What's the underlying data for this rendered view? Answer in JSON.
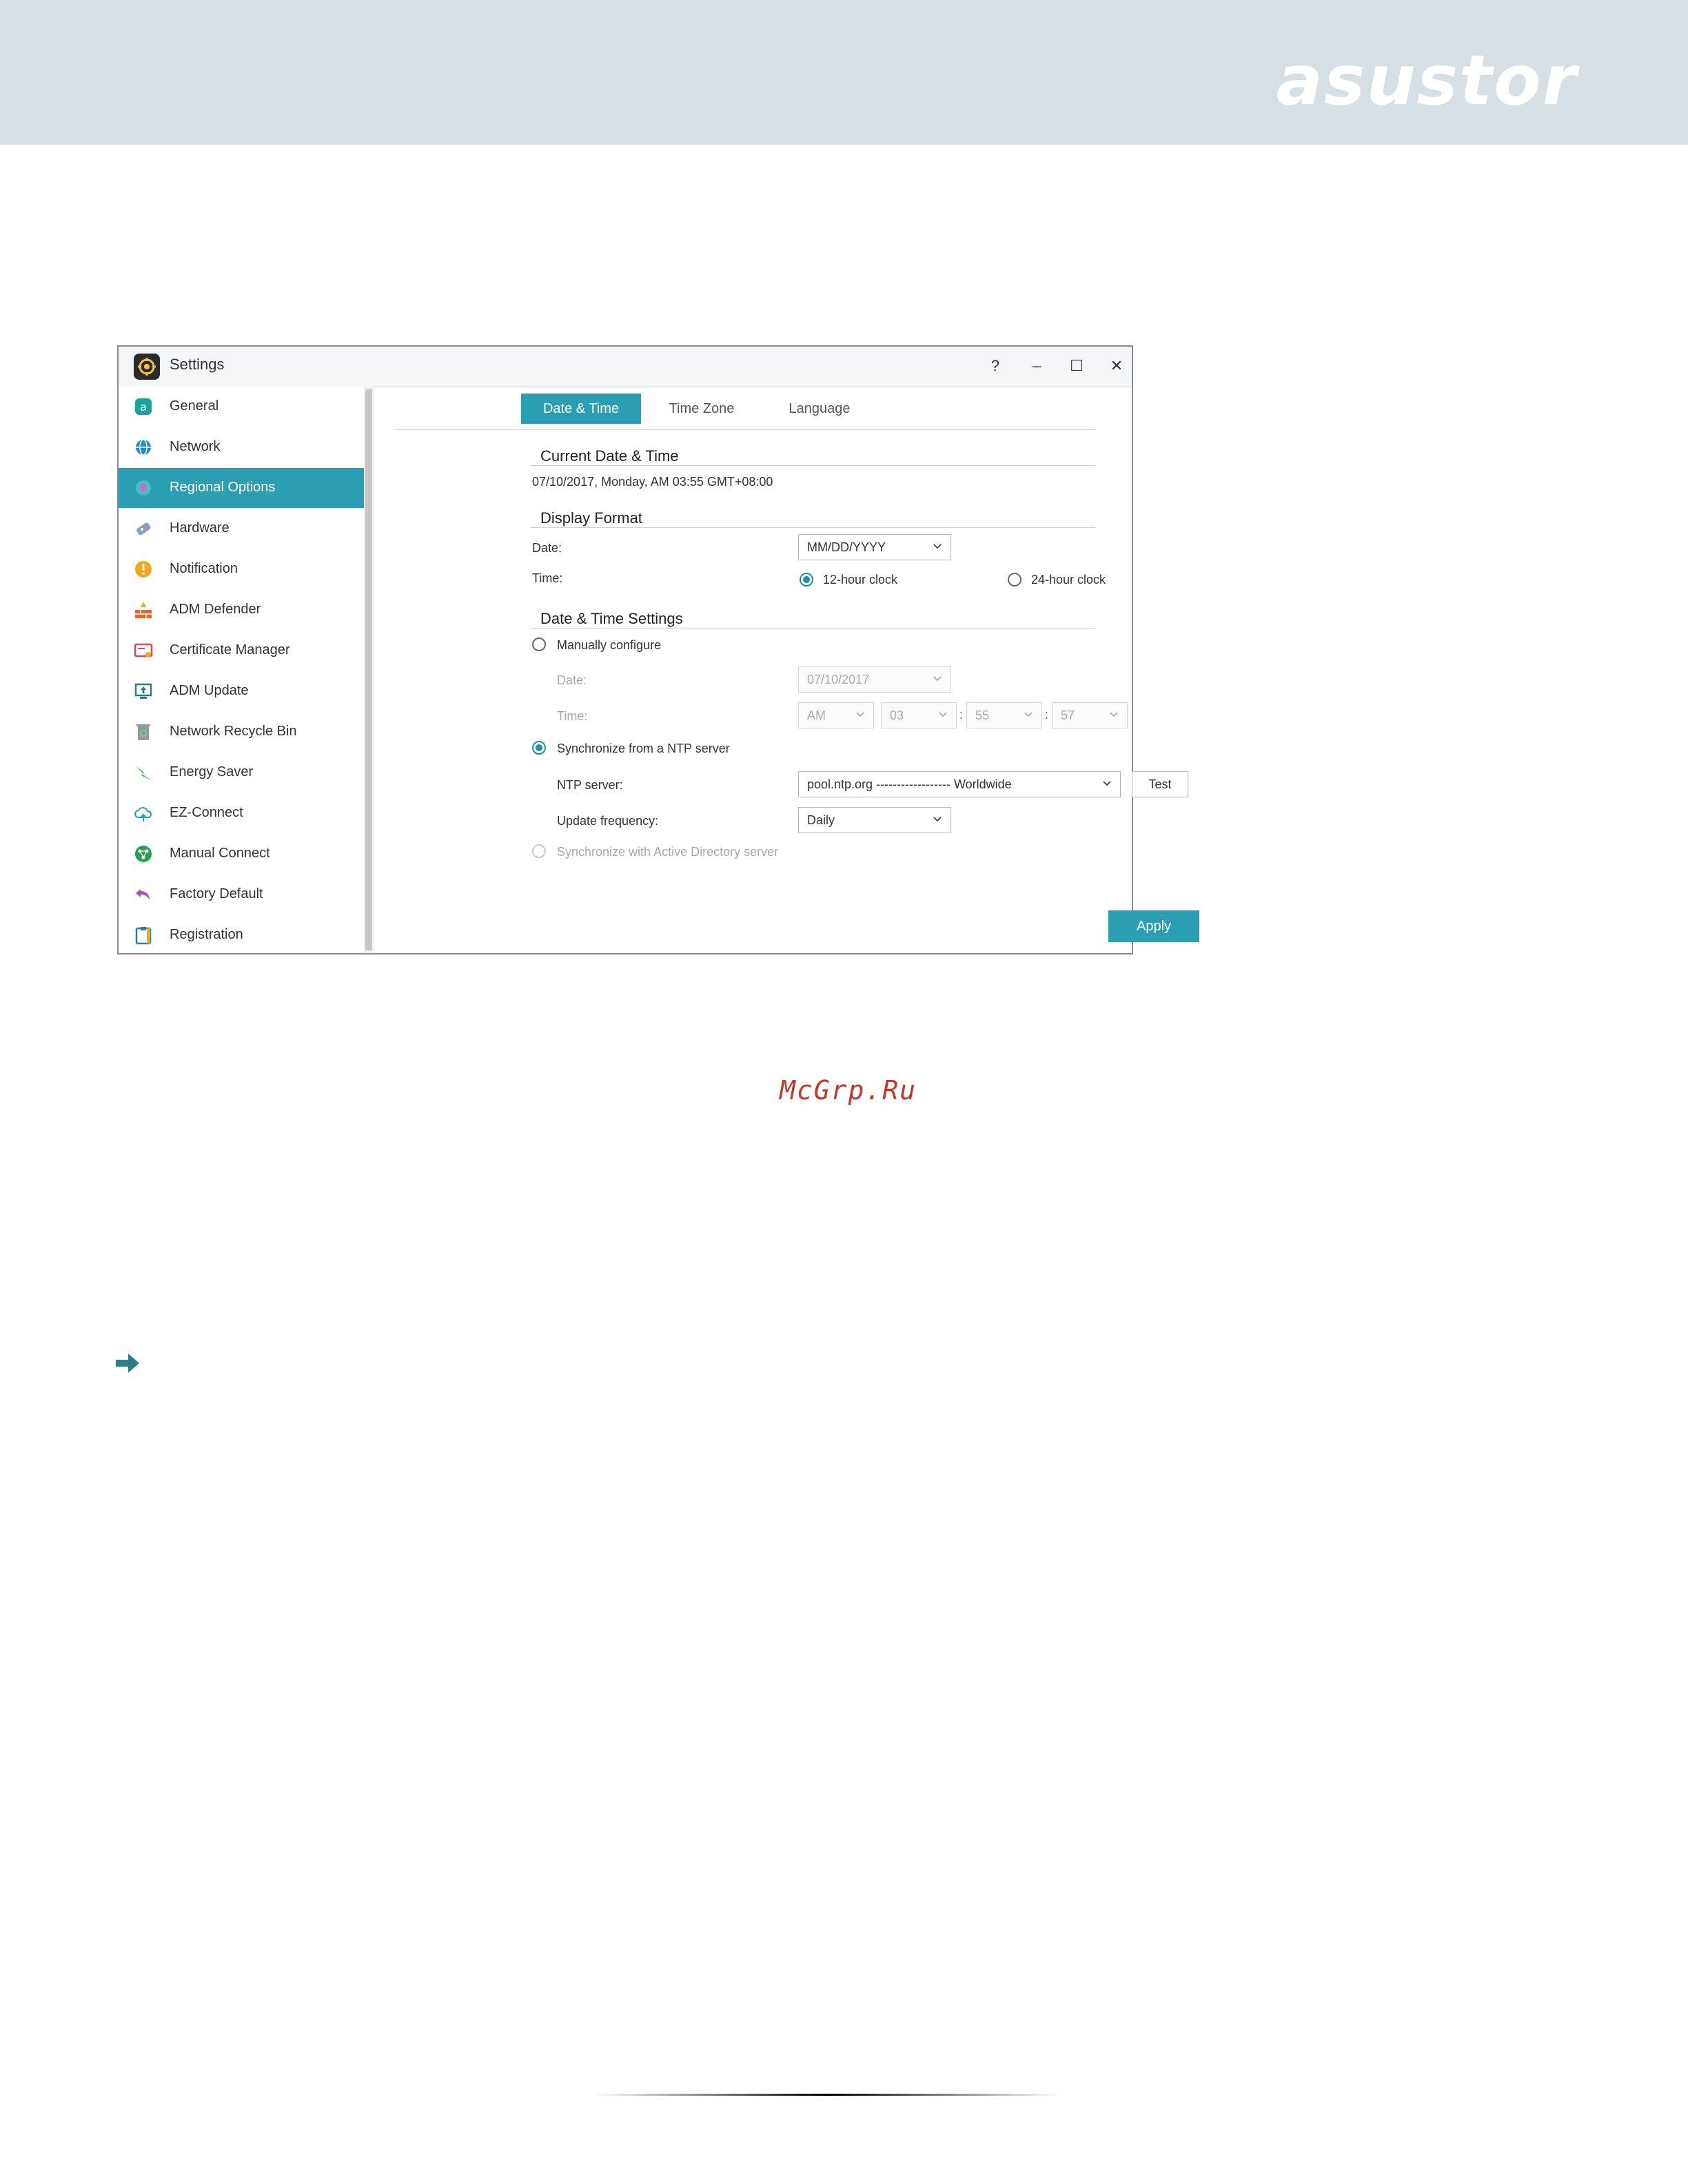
{
  "brand": {
    "logo_text": "asustor"
  },
  "window": {
    "title": "Settings",
    "controls": {
      "help": "?",
      "minimize": "–",
      "maximize": "☐",
      "close": "✕"
    }
  },
  "sidebar": {
    "items": [
      {
        "label": "General",
        "icon": "general-icon",
        "color": "#1aa39b"
      },
      {
        "label": "Network",
        "icon": "globe-icon",
        "color": "#1f8fc4"
      },
      {
        "label": "Regional Options",
        "icon": "map-pin-icon",
        "color": "#e05bc4",
        "active": true
      },
      {
        "label": "Hardware",
        "icon": "hardware-icon",
        "color": "#8aa0b8"
      },
      {
        "label": "Notification",
        "icon": "alert-icon",
        "color": "#f2a81d"
      },
      {
        "label": "ADM Defender",
        "icon": "firewall-icon",
        "color": "#e8632a"
      },
      {
        "label": "Certificate Manager",
        "icon": "certificate-icon",
        "color": "#e0445a"
      },
      {
        "label": "ADM Update",
        "icon": "update-icon",
        "color": "#2a7f78"
      },
      {
        "label": "Network Recycle Bin",
        "icon": "recycle-bin-icon",
        "color": "#8c9aa0"
      },
      {
        "label": "Energy Saver",
        "icon": "energy-icon",
        "color": "#3bb24a"
      },
      {
        "label": "EZ-Connect",
        "icon": "cloud-icon",
        "color": "#2a9fb0"
      },
      {
        "label": "Manual Connect",
        "icon": "manual-connect-icon",
        "color": "#2a9e55"
      },
      {
        "label": "Factory Default",
        "icon": "undo-icon",
        "color": "#b04fc4"
      },
      {
        "label": "Registration",
        "icon": "clipboard-icon",
        "color": "#2a7fb0"
      }
    ]
  },
  "tabs": [
    {
      "label": "Date & Time",
      "active": true
    },
    {
      "label": "Time Zone"
    },
    {
      "label": "Language"
    }
  ],
  "current": {
    "title": "Current Date & Time",
    "value": "07/10/2017, Monday, AM 03:55 GMT+08:00"
  },
  "display_format": {
    "title": "Display Format",
    "date_label": "Date:",
    "date_value": "MM/DD/YYYY",
    "time_label": "Time:",
    "clock12": "12-hour clock",
    "clock24": "24-hour clock",
    "selected": "12-hour clock"
  },
  "settings": {
    "title": "Date & Time Settings",
    "manual_label": "Manually configure",
    "manual_date_label": "Date:",
    "manual_date_value": "07/10/2017",
    "manual_time_label": "Time:",
    "ampm": "AM",
    "hour": "03",
    "minute": "55",
    "second": "57",
    "colon": ":",
    "ntp_label": "Synchronize from a NTP server",
    "ntp_server_label": "NTP server:",
    "ntp_server_value": "pool.ntp.org ------------------ Worldwide",
    "test_label": "Test",
    "freq_label": "Update frequency:",
    "freq_value": "Daily",
    "ad_label": "Synchronize with Active Directory server"
  },
  "apply_label": "Apply",
  "watermark": "McGrp.Ru",
  "colors": {
    "accent": "#2b9eb3",
    "header_bg": "#d6dfe4",
    "watermark": "#c0392b"
  }
}
